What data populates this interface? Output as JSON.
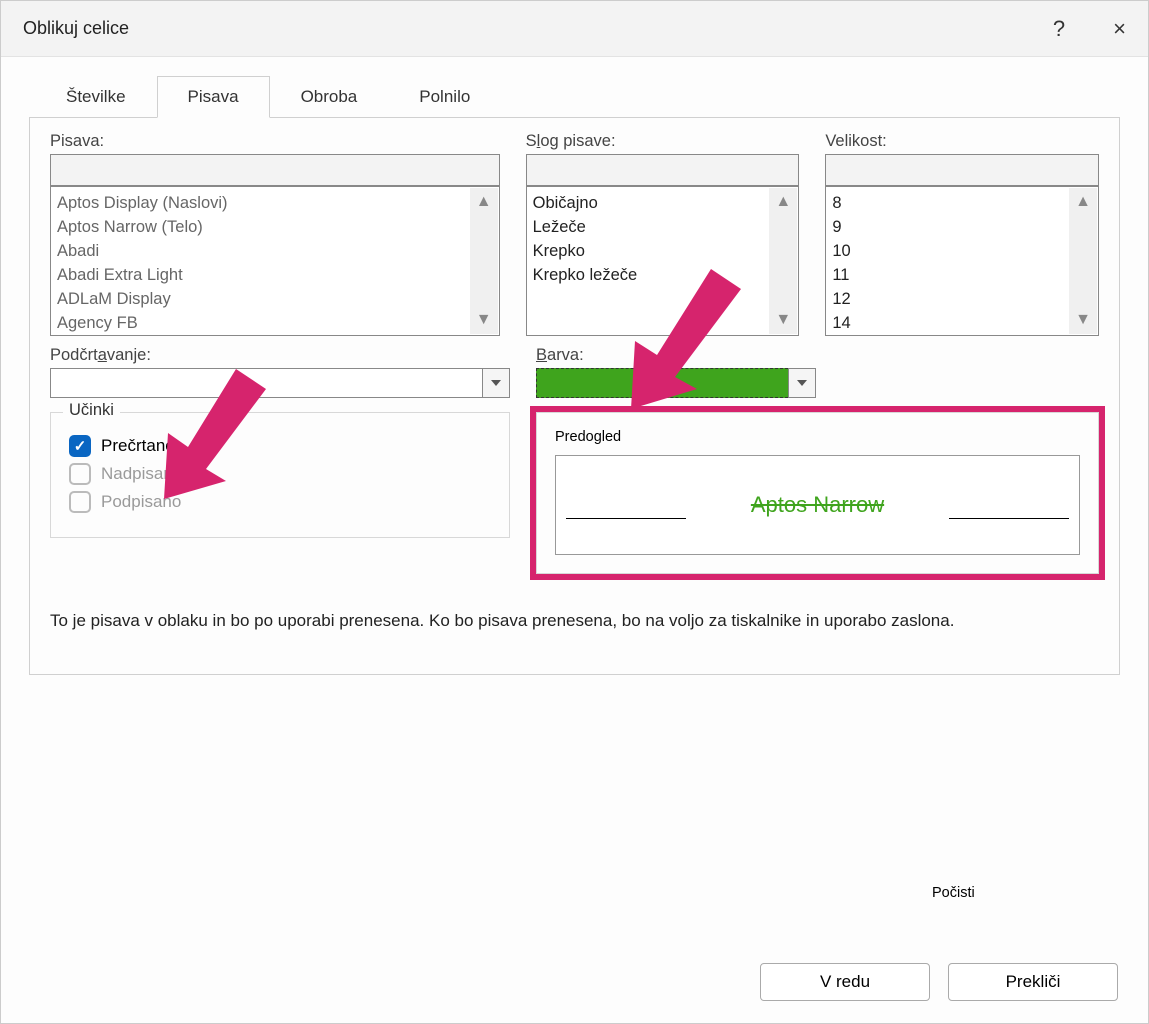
{
  "titlebar": {
    "title": "Oblikuj celice",
    "help": "?",
    "close": "×"
  },
  "tabs": [
    {
      "label": "Številke"
    },
    {
      "label": "Pisava"
    },
    {
      "label": "Obroba"
    },
    {
      "label": "Polnilo"
    }
  ],
  "font": {
    "label": "Pisava:",
    "input": "",
    "items": [
      "Aptos Display (Naslovi)",
      "Aptos Narrow (Telo)",
      "Abadi",
      "Abadi Extra Light",
      "ADLaM Display",
      "Agency FB"
    ]
  },
  "style": {
    "label_pre": "S",
    "label_u": "l",
    "label_post": "og pisave:",
    "input": "",
    "items": [
      "Običajno",
      "Ležeče",
      "Krepko",
      "Krepko ležeče"
    ]
  },
  "size": {
    "label": "Velikost:",
    "input": "",
    "items": [
      "8",
      "9",
      "10",
      "11",
      "12",
      "14"
    ]
  },
  "underline": {
    "label_pre": "Podčrt",
    "label_u": "a",
    "label_post": "vanje:",
    "value": ""
  },
  "color": {
    "label_pre": "",
    "label_u": "B",
    "label_post": "arva:",
    "swatch_hex": "#3fa41d"
  },
  "effects": {
    "group_label": "Učinki",
    "strike_pre": "Prečr",
    "strike_u": "t",
    "strike_post": "ano",
    "superscript": "Nadpisano",
    "subscript": "Podpisano",
    "strike_checked": true
  },
  "preview": {
    "group_label": "Predogled",
    "sample_text": "Aptos Narrow"
  },
  "info_text": "To je pisava v oblaku in bo po uporabi prenesena. Ko bo pisava prenesena, bo na voljo za tiskalnike in uporabo zaslona.",
  "buttons": {
    "clear_pre": "Po",
    "clear_u": "č",
    "clear_post": "isti",
    "ok": "V redu",
    "cancel": "Prekliči"
  }
}
